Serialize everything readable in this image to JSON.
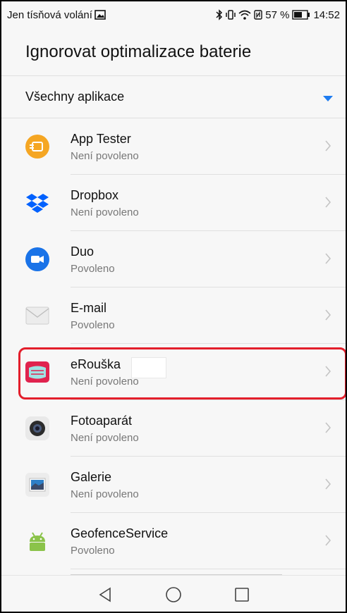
{
  "status_bar": {
    "carrier_text": "Jen tísňová volání",
    "battery_percent": "57 %",
    "time": "14:52"
  },
  "header": {
    "title": "Ignorovat optimalizace baterie"
  },
  "filter": {
    "selected": "Všechny aplikace"
  },
  "apps": [
    {
      "name": "App Tester",
      "status": "Není povoleno",
      "icon": "app-tester-icon",
      "color": "#f5a623"
    },
    {
      "name": "Dropbox",
      "status": "Není povoleno",
      "icon": "dropbox-icon",
      "color": "#0061fe"
    },
    {
      "name": "Duo",
      "status": "Povoleno",
      "icon": "duo-icon",
      "color": "#1a73e8"
    },
    {
      "name": "E-mail",
      "status": "Povoleno",
      "icon": "email-icon",
      "color": "#e8e8e8"
    },
    {
      "name": "eRouška",
      "status": "Není povoleno",
      "icon": "erouska-icon",
      "color": "#e0234e"
    },
    {
      "name": "Fotoaparát",
      "status": "Není povoleno",
      "icon": "camera-icon",
      "color": "#555555"
    },
    {
      "name": "Galerie",
      "status": "Není povoleno",
      "icon": "gallery-icon",
      "color": "#2e7fc7"
    },
    {
      "name": "GeofenceService",
      "status": "Povoleno",
      "icon": "android-icon",
      "color": "#8bc34a"
    }
  ],
  "colors": {
    "accent": "#1e7cf0",
    "highlight": "#e31e2b"
  }
}
